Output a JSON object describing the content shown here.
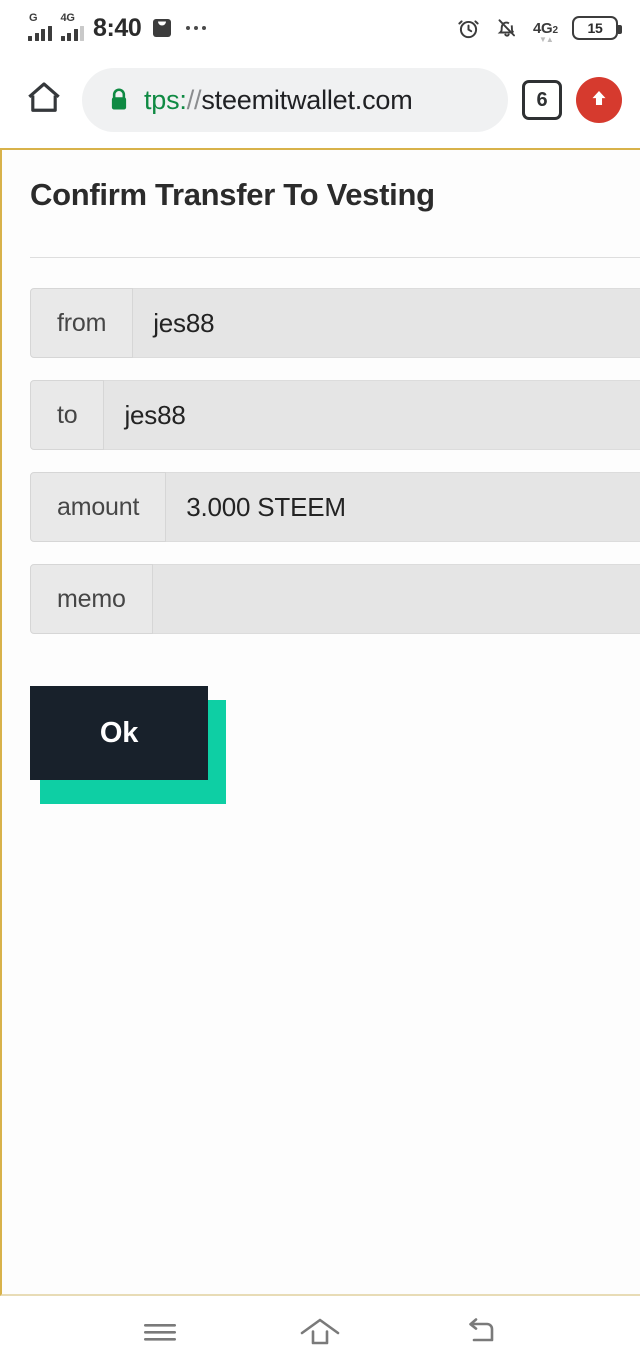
{
  "status_bar": {
    "time": "8:40",
    "signal_1_label": "G",
    "signal_2_label": "4G",
    "overflow_icon": "more-dots-icon",
    "alarm_icon": "alarm-clock-icon",
    "mute_icon": "bell-muted-icon",
    "network_label": "4G",
    "network_sub": "2",
    "battery_level": "15"
  },
  "browser": {
    "home_icon": "home-icon",
    "lock_icon": "padlock-icon",
    "url_scheme": "tps:",
    "url_sep": "//",
    "url_host": "steemitwallet.com",
    "url_full": "tps://steemitwallet.com",
    "tab_count": "6",
    "upload_icon": "upload-arrow-icon",
    "accent_red": "#d63a2e",
    "accent_green": "#0f8a43"
  },
  "page": {
    "title": "Confirm Transfer To Vesting",
    "fields": [
      {
        "label": "from",
        "value": "jes88"
      },
      {
        "label": "to",
        "value": "jes88"
      },
      {
        "label": "amount",
        "value": "3.000 STEEM"
      },
      {
        "label": "memo",
        "value": ""
      }
    ],
    "ok_button": "Ok",
    "button_color": "#18212b",
    "button_shadow_color": "#0ecfa4",
    "border_color": "#d8b24a"
  },
  "navigation": {
    "recents_icon": "menu-hamburger-icon",
    "home_icon": "home-outline-icon",
    "back_icon": "back-arrow-icon"
  }
}
